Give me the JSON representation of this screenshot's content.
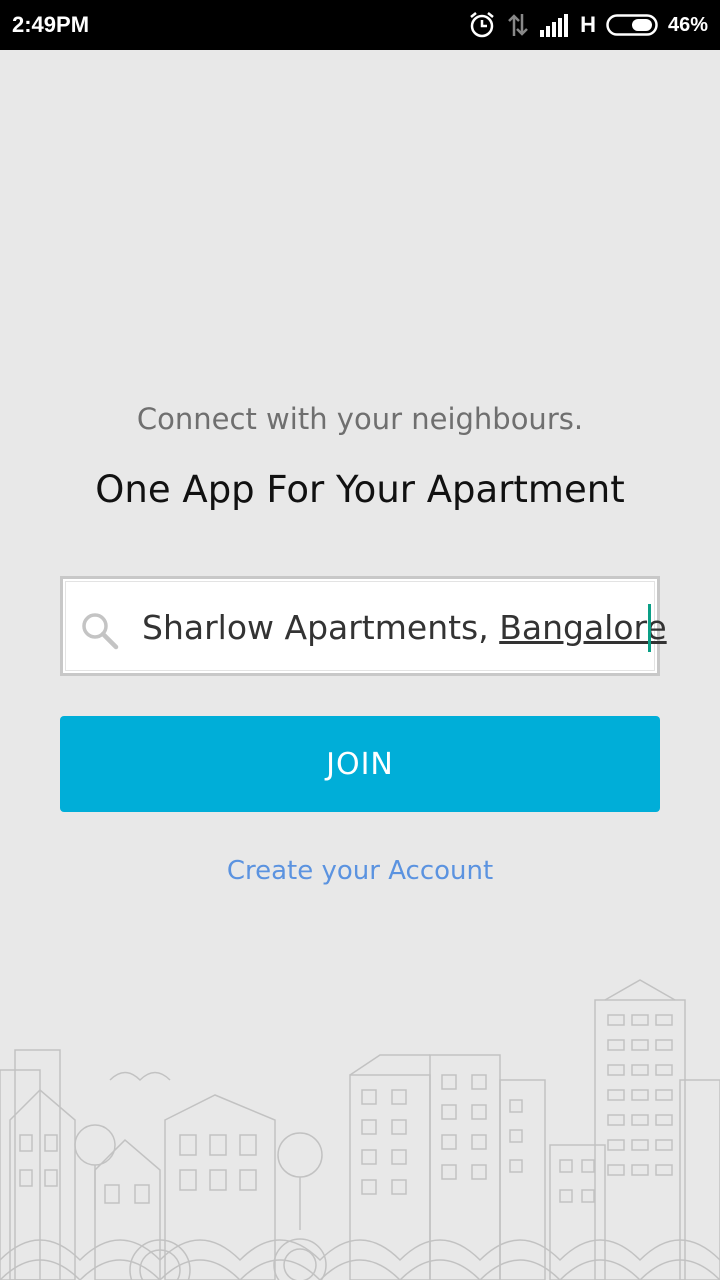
{
  "status_bar": {
    "time": "2:49PM",
    "network_type": "H",
    "battery_percent": "46%",
    "icons": [
      "alarm-icon",
      "data-transfer-icon",
      "signal-icon",
      "battery-icon"
    ]
  },
  "onboarding": {
    "tagline": "Connect with your neighbours.",
    "headline": "One App For Your Apartment"
  },
  "search": {
    "value_prefix": "Sharlow Apartments, ",
    "value_underlined": "Bangalore",
    "icon": "search-icon"
  },
  "actions": {
    "join_label": "JOIN",
    "create_account_label": "Create your Account"
  },
  "colors": {
    "background": "#e8e8e8",
    "join_button": "#00aed8",
    "link": "#5b93e0",
    "cursor": "#0a9f86"
  }
}
